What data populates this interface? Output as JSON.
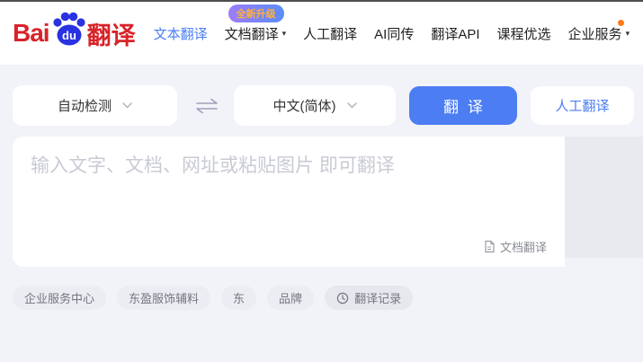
{
  "header": {
    "logo": {
      "bai": "Bai",
      "du": "du",
      "suffix": "翻译"
    },
    "nav": [
      {
        "label": "文本翻译"
      },
      {
        "label": "文档翻译",
        "badge": "全新升级"
      },
      {
        "label": "人工翻译"
      },
      {
        "label": "AI同传"
      },
      {
        "label": "翻译API"
      },
      {
        "label": "课程优选"
      },
      {
        "label": "企业服务"
      }
    ]
  },
  "controls": {
    "source_lang": "自动检测",
    "target_lang": "中文(简体)",
    "translate_label": "翻译",
    "human_translate_label": "人工翻译"
  },
  "editor": {
    "placeholder": "输入文字、文档、网址或粘贴图片 即可翻译",
    "doc_translate_label": "文档翻译"
  },
  "tags": {
    "items": [
      "企业服务中心",
      "东盈服饰辅料",
      "东",
      "品牌"
    ],
    "history_label": "翻译记录"
  },
  "icons": {
    "caret_down": "▾"
  },
  "colors": {
    "accent_blue": "#4d7df2",
    "logo_red": "#d8232a",
    "paw_blue": "#2932e1",
    "badge_text_orange": "#ffb03a",
    "notice_dot_orange": "#ff7a1a",
    "output_panel_gray": "#e9eaf0"
  }
}
